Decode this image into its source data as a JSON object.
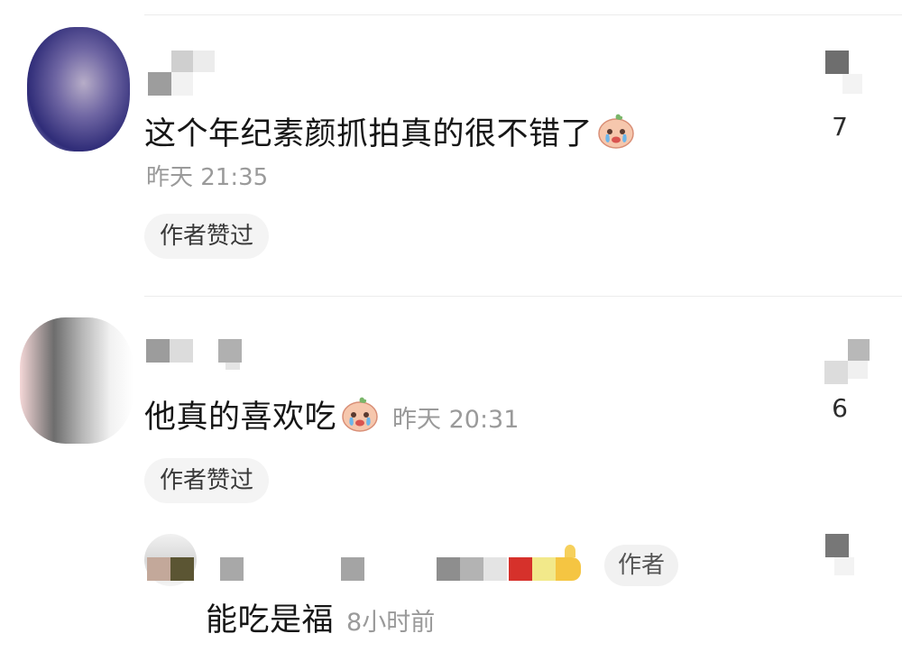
{
  "comments": [
    {
      "text": "这个年纪素颜抓拍真的很不错了",
      "time": "昨天 21:35",
      "badge": "作者赞过",
      "likes": "7",
      "emoji": "crying-face-emoji"
    },
    {
      "text": "他真的喜欢吃",
      "time": "昨天 20:31",
      "badge": "作者赞过",
      "likes": "6",
      "emoji": "crying-face-emoji"
    }
  ],
  "reply": {
    "author_tag": "作者",
    "text": "能吃是福",
    "time": "8小时前"
  },
  "colors": {
    "text": "#161616",
    "meta": "#9a9a9a",
    "badge_bg": "#f4f4f4",
    "divider": "#ececec"
  }
}
